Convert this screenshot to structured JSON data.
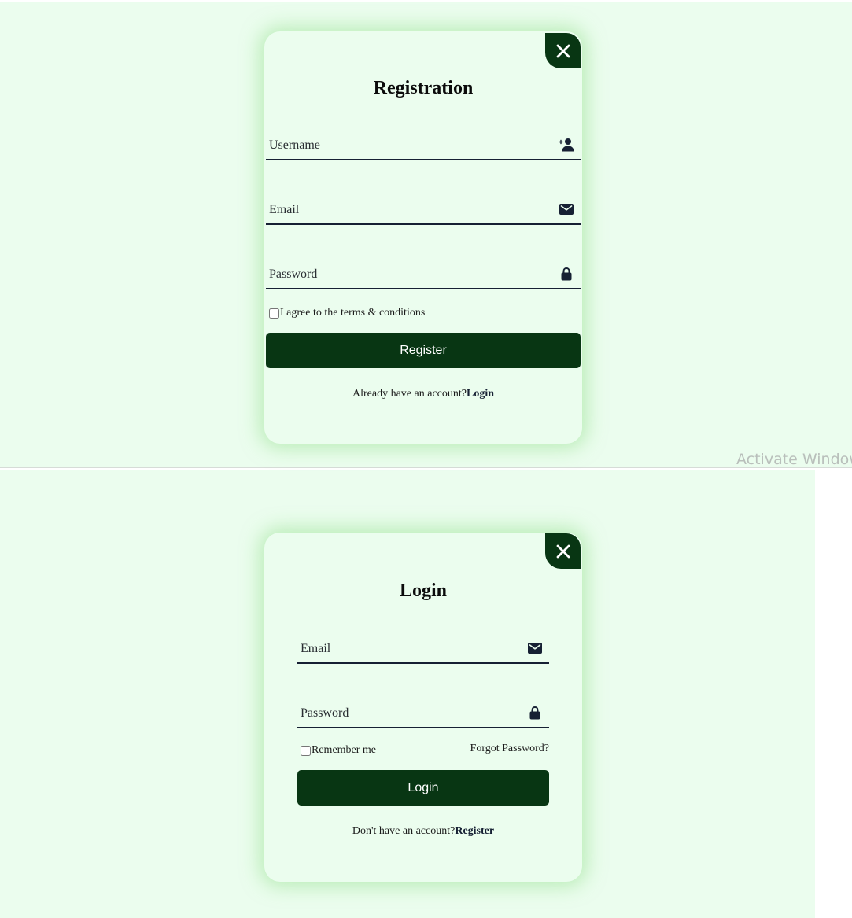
{
  "registration": {
    "title": "Registration",
    "username_placeholder": "Username",
    "email_placeholder": "Email",
    "password_placeholder": "Password",
    "terms_label": "I agree to the terms & conditions",
    "submit_label": "Register",
    "switch_text": "Already have an account?",
    "switch_link": "Login",
    "icons": {
      "close": "close-icon",
      "username": "user-plus-icon",
      "email": "envelope-icon",
      "password": "lock-icon"
    }
  },
  "login": {
    "title": "Login",
    "email_placeholder": "Email",
    "password_placeholder": "Password",
    "remember_label": "Remember me",
    "forgot_label": "Forgot Password?",
    "submit_label": "Login",
    "switch_text": "Don't have an account?",
    "switch_link": "Register",
    "icons": {
      "close": "close-icon",
      "email": "envelope-icon",
      "password": "lock-icon"
    }
  },
  "system": {
    "watermark": "Activate Window"
  },
  "colors": {
    "background": "#ebfdee",
    "accent": "#083613",
    "field_line": "#162033",
    "glow": "#92e08a"
  }
}
